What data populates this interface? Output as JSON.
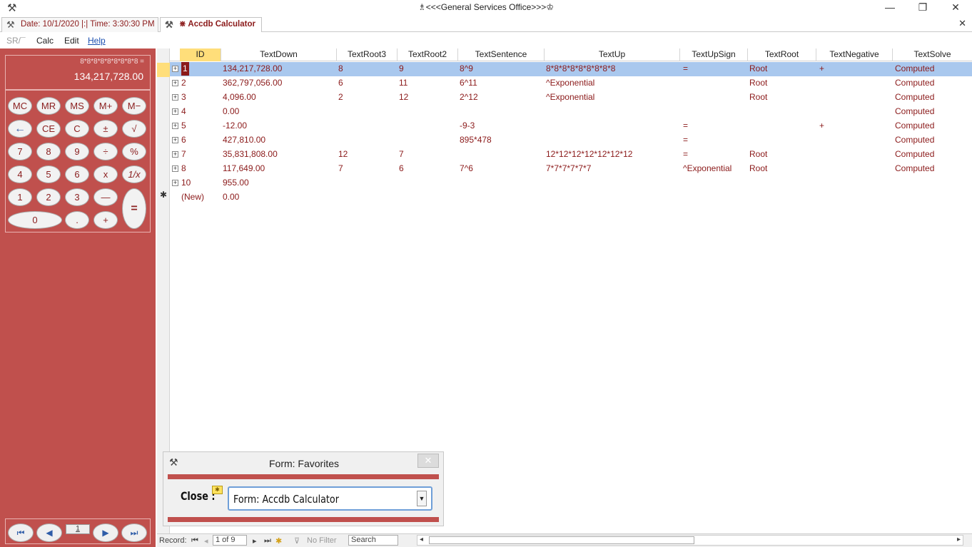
{
  "window": {
    "title": "♗<<<General Services Office>>>♔",
    "minimize": "—",
    "restore": "❐",
    "close": "✕"
  },
  "tabs": [
    {
      "label": "Date: 10/1/2020 |:| Time: 3:30:30 PM"
    },
    {
      "label": "⋇ Accdb Calculator"
    }
  ],
  "tab_close": "✕",
  "menu": {
    "sr": "SR/¯",
    "calc": "Calc",
    "edit": "Edit",
    "help": "Help"
  },
  "calculator": {
    "expression": "8*8*8*8*8*8*8*8*8 =",
    "display": "134,217,728.00",
    "keys": [
      "MC",
      "MR",
      "MS",
      "M+",
      "M−",
      "←",
      "CE",
      "C",
      "±",
      "√",
      "7",
      "8",
      "9",
      "÷",
      "%",
      "4",
      "5",
      "6",
      "x",
      "1/x",
      "1",
      "2",
      "3",
      "—",
      "=",
      "0",
      ".",
      "+"
    ],
    "nav_number": "1"
  },
  "datasheet": {
    "columns": [
      "ID",
      "TextDown",
      "TextRoot3",
      "TextRoot2",
      "TextSentence",
      "TextUp",
      "TextUpSign",
      "TextRoot",
      "TextNegative",
      "TextSolve"
    ],
    "rows": [
      {
        "id": "1",
        "down": "134,217,728.00",
        "r3": "8",
        "r2": "9",
        "sent": "8^9",
        "up": "8*8*8*8*8*8*8*8*8",
        "upsign": "=",
        "root": "Root",
        "neg": "+",
        "solve": "Computed"
      },
      {
        "id": "2",
        "down": "362,797,056.00",
        "r3": "6",
        "r2": "11",
        "sent": "6^11",
        "up": "^Exponential",
        "upsign": "",
        "root": "Root",
        "neg": "",
        "solve": "Computed"
      },
      {
        "id": "3",
        "down": "4,096.00",
        "r3": "2",
        "r2": "12",
        "sent": "2^12",
        "up": "^Exponential",
        "upsign": "",
        "root": "Root",
        "neg": "",
        "solve": "Computed"
      },
      {
        "id": "4",
        "down": "0.00",
        "r3": "",
        "r2": "",
        "sent": "",
        "up": "",
        "upsign": "",
        "root": "",
        "neg": "",
        "solve": "Computed"
      },
      {
        "id": "5",
        "down": "-12.00",
        "r3": "",
        "r2": "",
        "sent": "-9-3",
        "up": "",
        "upsign": "=",
        "root": "",
        "neg": "+",
        "solve": "Computed"
      },
      {
        "id": "6",
        "down": "427,810.00",
        "r3": "",
        "r2": "",
        "sent": "895*478",
        "up": "",
        "upsign": "=",
        "root": "",
        "neg": "",
        "solve": "Computed"
      },
      {
        "id": "7",
        "down": "35,831,808.00",
        "r3": "12",
        "r2": "7",
        "sent": "",
        "up": "12*12*12*12*12*12*12",
        "upsign": "=",
        "root": "Root",
        "neg": "",
        "solve": "Computed"
      },
      {
        "id": "8",
        "down": "117,649.00",
        "r3": "7",
        "r2": "6",
        "sent": "7^6",
        "up": "7*7*7*7*7*7",
        "upsign": "^Exponential",
        "root": "Root",
        "neg": "",
        "solve": "Computed"
      },
      {
        "id": "10",
        "down": "955.00",
        "r3": "",
        "r2": "",
        "sent": "",
        "up": "",
        "upsign": "",
        "root": "",
        "neg": "",
        "solve": ""
      }
    ],
    "new_row": {
      "id": "(New)",
      "down": "0.00"
    }
  },
  "favorites": {
    "title": "Form: Favorites",
    "close_x": "✕",
    "label": "Close :",
    "selected": "Form: Accdb Calculator"
  },
  "statusbar": {
    "record_label": "Record:",
    "record_value": "1 of 9",
    "filter": "No Filter",
    "search": "Search"
  }
}
